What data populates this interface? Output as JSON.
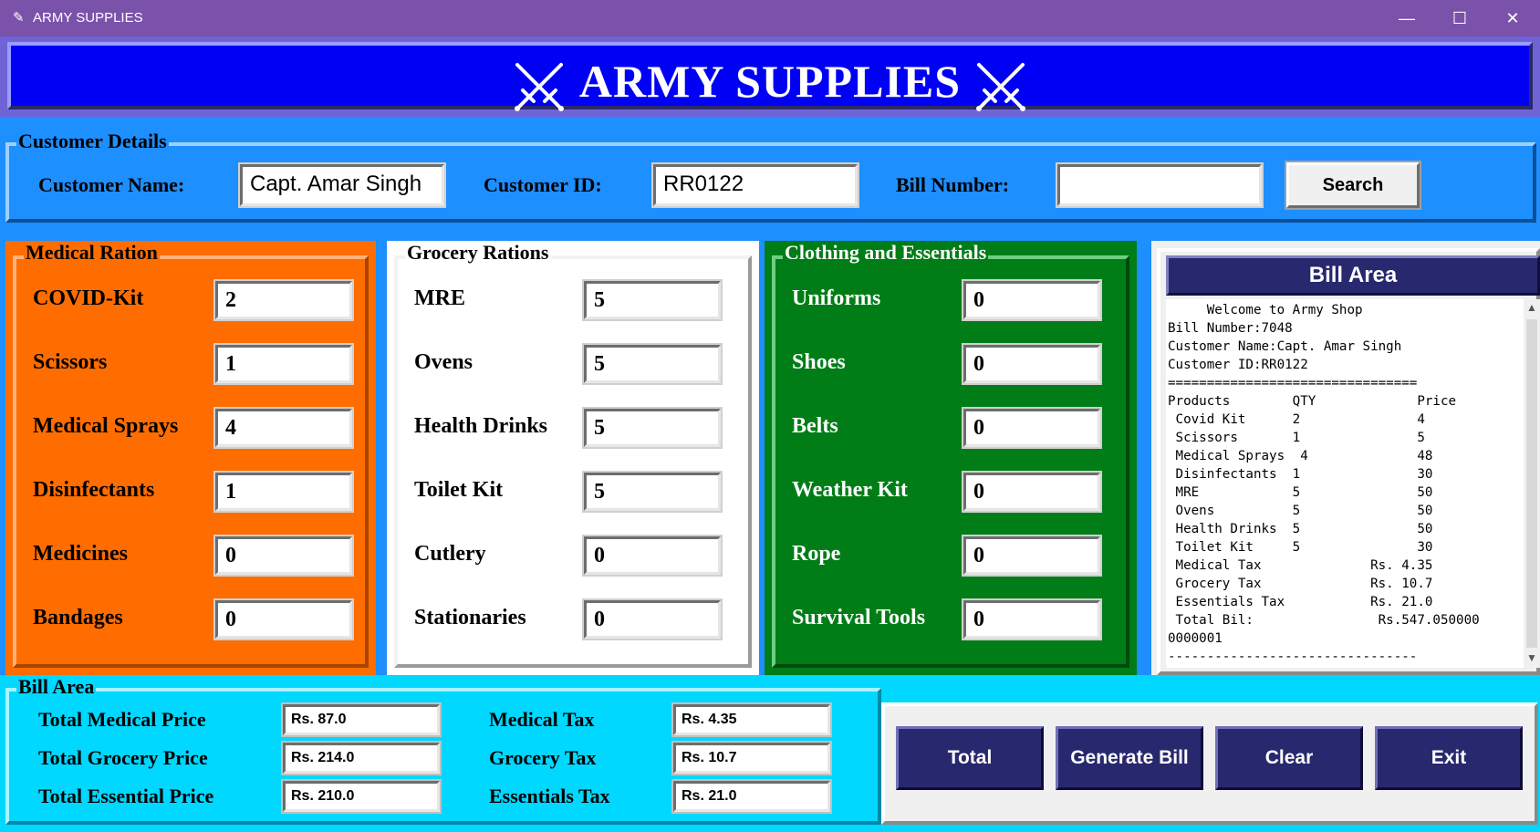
{
  "window": {
    "title": "ARMY SUPPLIES",
    "minimize": "—",
    "maximize": "☐",
    "close": "✕"
  },
  "header": {
    "title": "ARMY SUPPLIES",
    "icon": "crossed-swords-icon"
  },
  "customer": {
    "group_label": "Customer Details",
    "name_label": "Customer Name:",
    "name_value": "Capt. Amar Singh",
    "id_label": "Customer ID:",
    "id_value": "RR0122",
    "bill_label": "Bill Number:",
    "bill_value": "",
    "search_label": "Search"
  },
  "medical": {
    "label": "Medical Ration",
    "items": [
      {
        "label": "COVID-Kit",
        "qty": "2"
      },
      {
        "label": "Scissors",
        "qty": "1"
      },
      {
        "label": "Medical Sprays",
        "qty": "4"
      },
      {
        "label": "Disinfectants",
        "qty": "1"
      },
      {
        "label": "Medicines",
        "qty": "0"
      },
      {
        "label": "Bandages",
        "qty": "0"
      }
    ]
  },
  "grocery": {
    "label": "Grocery Rations",
    "items": [
      {
        "label": "MRE",
        "qty": "5"
      },
      {
        "label": "Ovens",
        "qty": "5"
      },
      {
        "label": "Health Drinks",
        "qty": "5"
      },
      {
        "label": "Toilet Kit",
        "qty": "5"
      },
      {
        "label": "Cutlery",
        "qty": "0"
      },
      {
        "label": "Stationaries",
        "qty": "0"
      }
    ]
  },
  "clothing": {
    "label": "Clothing and Essentials",
    "items": [
      {
        "label": "Uniforms",
        "qty": "0"
      },
      {
        "label": "Shoes",
        "qty": "0"
      },
      {
        "label": "Belts",
        "qty": "0"
      },
      {
        "label": "Weather Kit",
        "qty": "0"
      },
      {
        "label": "Rope",
        "qty": "0"
      },
      {
        "label": "Survival Tools",
        "qty": "0"
      }
    ]
  },
  "bill": {
    "header": "Bill Area",
    "text": "     Welcome to Army Shop\nBill Number:7048\nCustomer Name:Capt. Amar Singh\nCustomer ID:RR0122\n================================\nProducts        QTY             Price\n Covid Kit      2               4\n Scissors       1               5\n Medical Sprays  4              48\n Disinfectants  1               30\n MRE            5               50\n Ovens          5               50\n Health Drinks  5               50\n Toilet Kit     5               30\n Medical Tax              Rs. 4.35\n Grocery Tax              Rs. 10.7\n Essentials Tax           Rs. 21.0\n Total Bil:                Rs.547.050000\n0000001\n--------------------------------"
  },
  "totals": {
    "group_label": "Bill Area",
    "medical_price_label": "Total Medical Price",
    "medical_price": "Rs. 87.0",
    "grocery_price_label": "Total Grocery Price",
    "grocery_price": "Rs. 214.0",
    "essential_price_label": "Total Essential Price",
    "essential_price": "Rs. 210.0",
    "medical_tax_label": "Medical Tax",
    "medical_tax": "Rs. 4.35",
    "grocery_tax_label": "Grocery Tax",
    "grocery_tax": "Rs. 10.7",
    "essentials_tax_label": "Essentials Tax",
    "essentials_tax": "Rs. 21.0"
  },
  "actions": {
    "total": "Total",
    "generate": "Generate Bill",
    "clear": "Clear",
    "exit": "Exit"
  }
}
